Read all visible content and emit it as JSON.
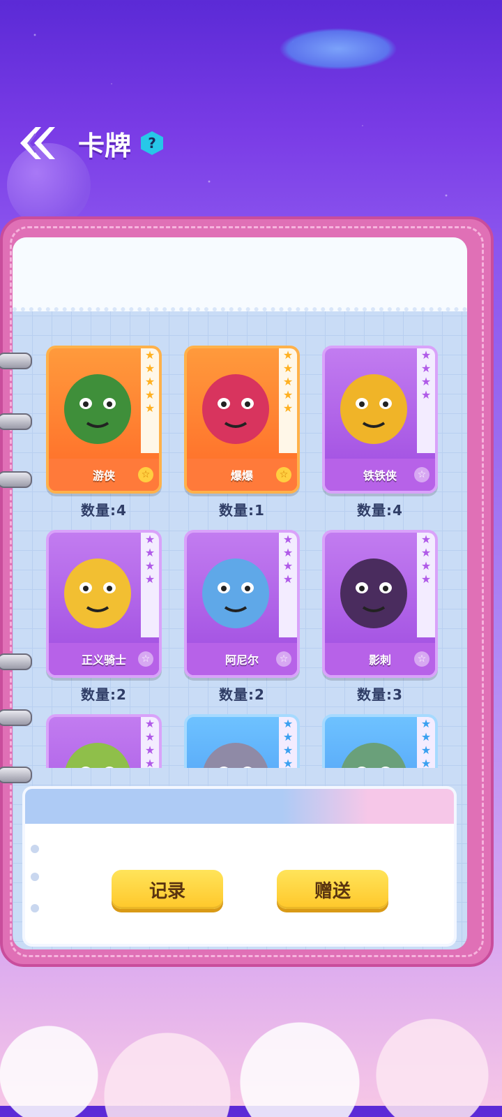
{
  "header": {
    "title": "卡牌",
    "help": "?"
  },
  "cards": [
    {
      "name": "游侠",
      "count": "数量:4",
      "rarity": "orange",
      "stars": 5,
      "color": "#3f8f3a"
    },
    {
      "name": "爆爆",
      "count": "数量:1",
      "rarity": "orange",
      "stars": 5,
      "color": "#d8345e"
    },
    {
      "name": "铁铁侠",
      "count": "数量:4",
      "rarity": "purple",
      "stars": 4,
      "color": "#f0b428"
    },
    {
      "name": "正义骑士",
      "count": "数量:2",
      "rarity": "purple",
      "stars": 4,
      "color": "#f2bf32"
    },
    {
      "name": "阿尼尔",
      "count": "数量:2",
      "rarity": "purple",
      "stars": 4,
      "color": "#5fa8e8"
    },
    {
      "name": "影刺",
      "count": "数量:3",
      "rarity": "purple",
      "stars": 4,
      "color": "#4a2c5e"
    },
    {
      "name": "",
      "count": "",
      "rarity": "purple",
      "stars": 4,
      "color": "#8fbf4a"
    },
    {
      "name": "",
      "count": "",
      "rarity": "blue",
      "stars": 4,
      "color": "#8f8aa6"
    },
    {
      "name": "",
      "count": "",
      "rarity": "blue",
      "stars": 4,
      "color": "#6aa07a"
    }
  ],
  "buttons": {
    "record": "记录",
    "gift": "赠送"
  }
}
